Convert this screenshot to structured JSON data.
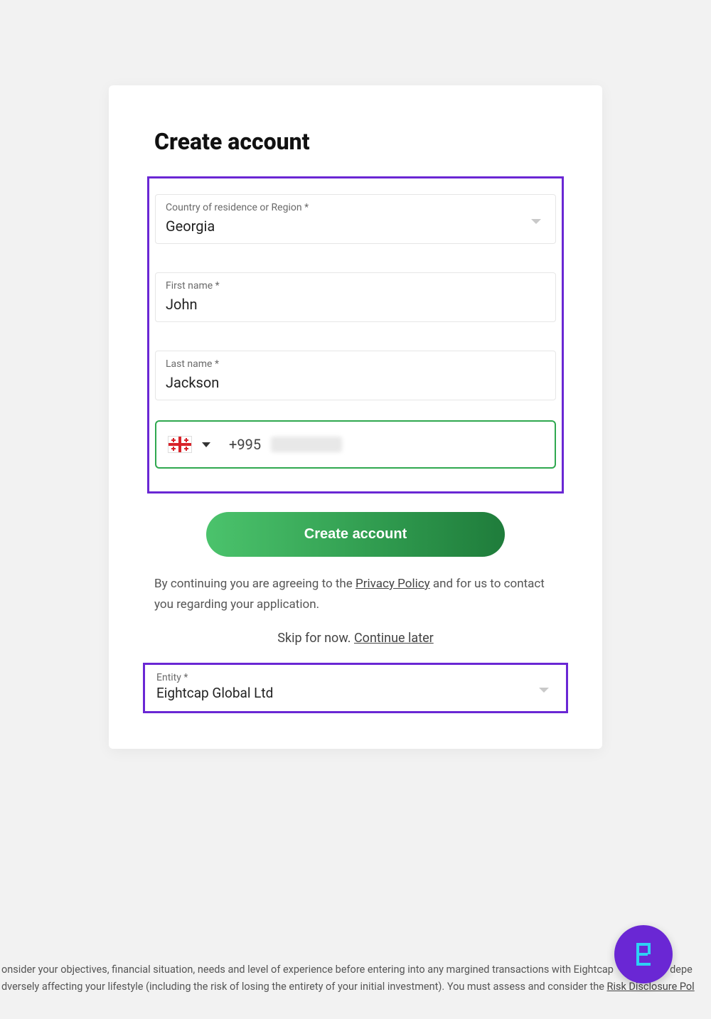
{
  "page": {
    "title": "Create account"
  },
  "fields": {
    "country": {
      "label": "Country of residence or Region *",
      "value": "Georgia"
    },
    "first_name": {
      "label": "First name *",
      "value": "John"
    },
    "last_name": {
      "label": "Last name *",
      "value": "Jackson"
    },
    "phone": {
      "prefix": "+995",
      "country_flag": "georgia"
    },
    "entity": {
      "label": "Entity *",
      "value": "Eightcap Global Ltd"
    }
  },
  "buttons": {
    "create": "Create account"
  },
  "consent": {
    "pre": "By continuing you are agreeing to the ",
    "link": "Privacy Policy",
    "post": " and for us to contact you regarding your application."
  },
  "skip": {
    "pre": "Skip for now. ",
    "link": "Continue later"
  },
  "disclaimer": {
    "line1_pre": "onsider your objectives, financial situation, needs and level of experience before entering into any margined transactions with Eightcap",
    "line1_post": "depe",
    "line2_pre": "dversely affecting your lifestyle (including the risk of losing the entirety of your initial investment). You must assess and consider the  ",
    "line2_link": "Risk Disclosure Pol"
  },
  "colors": {
    "highlight": "#6a27d4",
    "success": "#2fa84f",
    "button_gradient_from": "#4bc36c",
    "button_gradient_to": "#1f7c3b"
  }
}
